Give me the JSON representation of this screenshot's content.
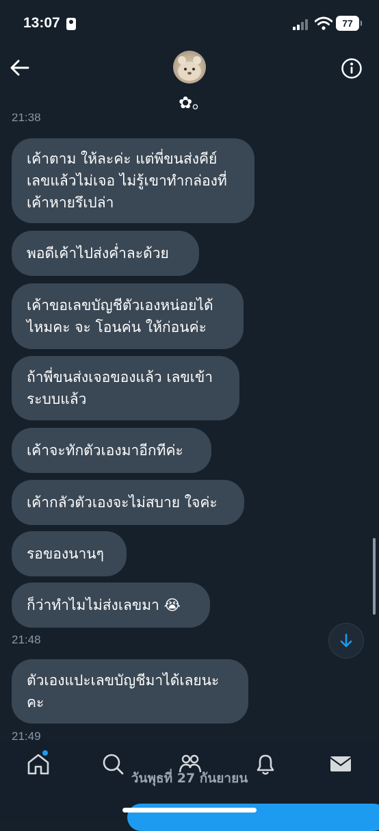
{
  "status_bar": {
    "time": "13:07",
    "battery": "77"
  },
  "header": {
    "contact_name": "✿｡",
    "back_icon": "arrow-left-icon",
    "info_icon": "info-circle-icon"
  },
  "messages": [
    {
      "type": "timestamp",
      "text": "21:38"
    },
    {
      "type": "bubble",
      "text": "เค้าตาม ให้ละค่ะ แต่พี่ขนส่งคีย์\nเลขแล้วไม่เจอ ไม่รู้เขาทำกล่องที่\nเค้าหายรึเปล่า"
    },
    {
      "type": "bubble",
      "text": "พอดีเค้าไปส่งค่ำละด้วย"
    },
    {
      "type": "bubble",
      "text": "เค้าขอเลขบัญชีตัวเองหน่อยได้\nไหมคะ จะ โอนค่น ให้ก่อนค่ะ"
    },
    {
      "type": "bubble",
      "text": "ถ้าพี่ขนส่งเจอของแล้ว เลขเข้า\nระบบแล้ว"
    },
    {
      "type": "bubble",
      "text": "เค้าจะทักตัวเองมาอีกทีค่ะ"
    },
    {
      "type": "bubble",
      "text": "เค้ากลัวตัวเองจะไม่สบาย ใจค่ะ"
    },
    {
      "type": "bubble",
      "text": "รอของนานๆ"
    },
    {
      "type": "bubble",
      "text": "ก็ว่าทำไมไม่ส่งเลขมา 😭"
    },
    {
      "type": "timestamp",
      "text": "21:48"
    },
    {
      "type": "bubble",
      "text": "ตัวเองแปะเลขบัญชีมาได้เลยนะ\nคะ"
    },
    {
      "type": "timestamp",
      "text": "21:49"
    }
  ],
  "date_overlay": "วันพุธที่ 27 กันยายน",
  "tabs": [
    {
      "name": "home",
      "icon": "home-icon"
    },
    {
      "name": "search",
      "icon": "search-icon"
    },
    {
      "name": "communities",
      "icon": "people-icon"
    },
    {
      "name": "notifications",
      "icon": "bell-icon"
    },
    {
      "name": "messages",
      "icon": "envelope-icon"
    }
  ],
  "colors": {
    "background": "#15202b",
    "bubble": "#3a4754",
    "accent": "#1d9bf0",
    "muted_text": "#8b98a5"
  }
}
